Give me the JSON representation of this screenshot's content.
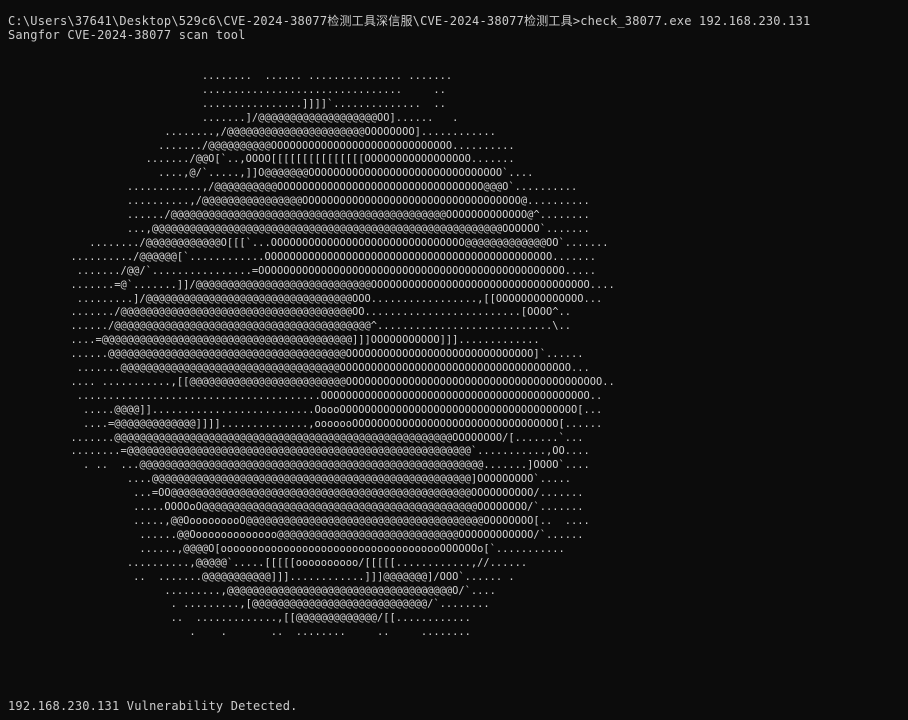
{
  "terminal": {
    "command_line": "C:\\Users\\37641\\Desktop\\529c6\\CVE-2024-38077检测工具深信服\\CVE-2024-38077检测工具>check_38077.exe 192.168.230.131",
    "tool_banner": "Sangfor CVE-2024-38077 scan tool",
    "ascii_art": "                       ........  ...... ............... .......\n                       ................................     ..\n                       ................]]]]`..............  ..\n                       .......]/@@@@@@@@@@@@@@@@@@@OO]......   .\n                 ........,/@@@@@@@@@@@@@@@@@@@@@@OOOOOOOO]............\n                ......./@@@@@@@@@@OOOOOOOOOOOOOOOOOOOOOOOOOOOOO..........\n              ......./@@O[`..,OOOO[[[[[[[[[[[[[[[OOOOOOOOOOOOOOOOO.......\n                ....,@/`.....,]]O@@@@@@@OOOOOOOOOOOOOOOOOOOOOOOOOOOOOOO`....\n           ............,/@@@@@@@@@@OOOOOOOOOOOOOOOOOOOOOOOOOOOOOOOOO@@@O`..........\n           ..........,/@@@@@@@@@@@@@@@@OOOOOOOOOOOOOOOOOOOOOOOOOOOOOOOOOOO@..........\n           ....../@@@@@@@@@@@@@@@@@@@@@@@@@@@@@@@@@@@@@@@@@@@@OOOOOOOOOOOOO@^........\n           ...,@@@@@@@@@@@@@@@@@@@@@@@@@@@@@@@@@@@@@@@@@@@@@@@@@@@@@@@@OOOOOO`.......\n     ......../@@@@@@@@@@@@O[[[`...OOOOOOOOOOOOOOOOOOOOOOOOOOOOOOO@@@@@@@@@@@@@OO`.......\n  ........../@@@@@@[`............OOOOOOOOOOOOOOOOOOOOOOOOOOOOOOOOOOOOOOOOOOOOOO.......\n   ......./@@/`................=OOOOOOOOOOOOOOOOOOOOOOOOOOOOOOOOOOOOOOOOOOOOOOOOO.....\n  .......=@`.......]]/@@@@@@@@@@@@@@@@@@@@@@@@@@@@OOOOOOOOOOOOOOOOOOOOOOOOOOOOOOOOOOO....\n   .........]/@@@@@@@@@@@@@@@@@@@@@@@@@@@@@@@@@OOO.................,[[OOOOOOOOOOOOOO...\n  ......./@@@@@@@@@@@@@@@@@@@@@@@@@@@@@@@@@@@@@OO.........................[OOOO^..\n  ....../@@@@@@@@@@@@@@@@@@@@@@@@@@@@@@@@@@@@@@@@@^............................\\..\n  ....=@@@@@@@@@@@@@@@@@@@@@@@@@@@@@@@@@@@@@@@@]]]OOOOOOOOOOO]]].............\n  ......@@@@@@@@@@@@@@@@@@@@@@@@@@@@@@@@@@@@@@OOOOOOOOOOOOOOOOOOOOOOOOOOOOOO]`......\n   .......@@@@@@@@@@@@@@@@@@@@@@@@@@@@@@@@@@@OOOOOOOOOOOOOOOOOOOOOOOOOOOOOOOOOOOOO...\n  .... ...........,[[@@@@@@@@@@@@@@@@@@@@@@@@@OOOOOOOOOOOOOOOOOOOOOOOOOOOOOOOOOOOOOOOOO..\n   .......................................OOOOOOOOOOOOOOOOOOOOOOOOOOOOOOOOOOOOOOOOOOO..\n    .....@@@@]]..........................OoooOOOOOOOOOOOOOOOOOOOOOOOOOOOOOOOOOOOOOO[...\n    ....=@@@@@@@@@@@@@]]]]..............,ooooooOOOOOOOOOOOOOOOOOOOOOOOOOOOOOOOOO[......\n  .......@@@@@@@@@@@@@@@@@@@@@@@@@@@@@@@@@@@@@@@@@@@@@@@@@@@@@@OOOOOOOO/[.......`...\n  ........=@@@@@@@@@@@@@@@@@@@@@@@@@@@@@@@@@@@@@@@@@@@@@@@@@@@@@@@`...........,OO....\n    . ..  ...@@@@@@@@@@@@@@@@@@@@@@@@@@@@@@@@@@@@@@@@@@@@@@@@@@@@@@@.......]OOOO`....\n           ....@@@@@@@@@@@@@@@@@@@@@@@@@@@@@@@@@@@@@@@@@@@@@@@@@@@]OOOOOOOOO`.....\n            ...=OO@@@@@@@@@@@@@@@@@@@@@@@@@@@@@@@@@@@@@@@@@@@@@@@@OOOOOOOOOO/.......\n            .....OOOOoO@@@@@@@@@@@@@@@@@@@@@@@@@@@@@@@@@@@@@@@@@@@@OOOOOOOO/`.......\n            .....,@@OooooooooO@@@@@@@@@@@@@@@@@@@@@@@@@@@@@@@@@@@@@@OOOOOOOO[..  ....\n             ......@@Oooooooooooooo@@@@@@@@@@@@@@@@@@@@@@@@@@@@@OOOOOOOOOOOO/`......\n             ......,@@@@O[oooooooooooooooooooooooooooooooooooOOOOOOo[`...........\n           ..........,@@@@@`.....[[[[[oooooooooo/[[[[[............,//......\n            ..  .......@@@@@@@@@@@]]]............]]]@@@@@@@]/OOO`...... .\n                 .........,@@@@@@@@@@@@@@@@@@@@@@@@@@@@@@@@@@@@O/`....\n                  . .........,[@@@@@@@@@@@@@@@@@@@@@@@@@@@@/`........\n                  ..  .............,[[@@@@@@@@@@@@@/[[............\n                     .    .       ..  ........     ..     ........",
    "scan_result": "192.168.230.131 Vulnerability Detected."
  }
}
